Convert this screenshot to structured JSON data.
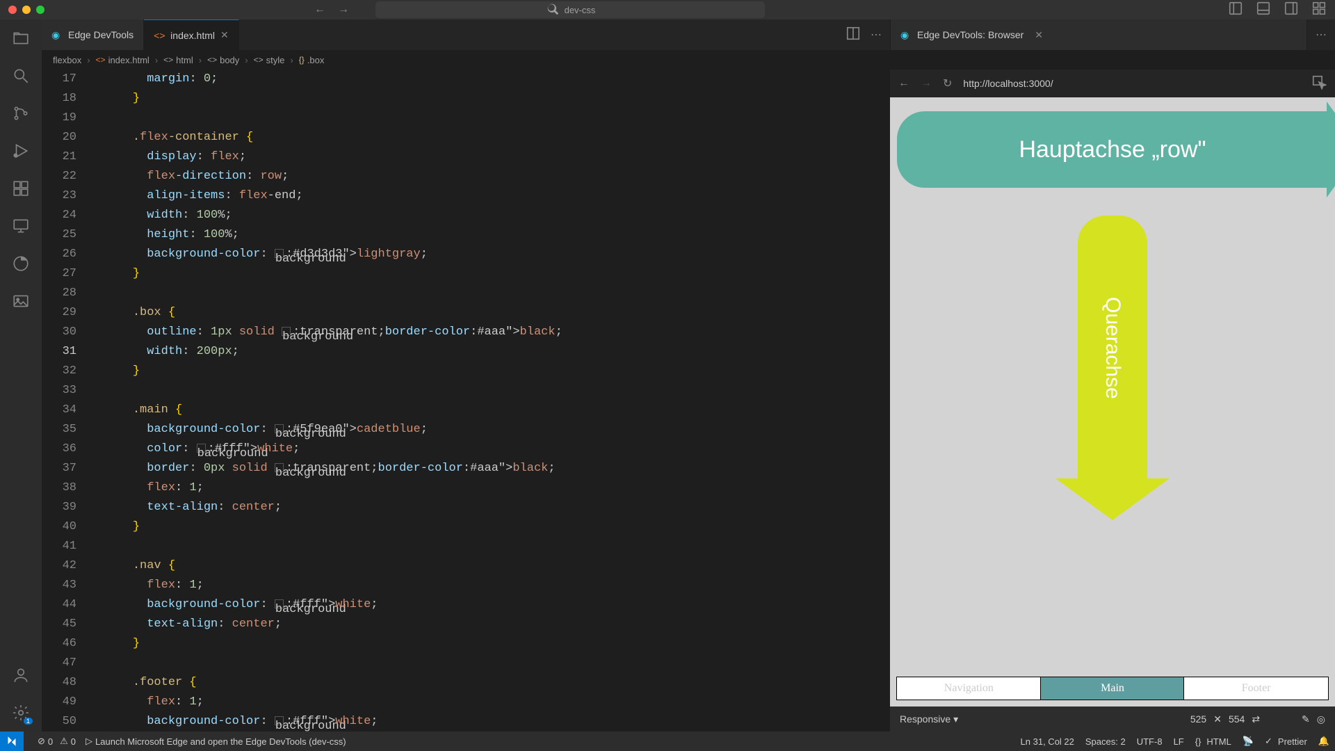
{
  "titlebar": {
    "search_text": "dev-css"
  },
  "tabs": {
    "left": [
      {
        "label": "Edge DevTools"
      },
      {
        "label": "index.html",
        "active": true,
        "dirty": false
      }
    ],
    "right": [
      {
        "label": "Edge DevTools: Browser"
      }
    ]
  },
  "breadcrumbs": [
    "flexbox",
    "index.html",
    "html",
    "body",
    "style",
    ".box"
  ],
  "editor": {
    "first_line": 17,
    "current_line": 31,
    "lines": [
      "      margin: 0;",
      "    }",
      "",
      "    .flex-container {",
      "      display: flex;",
      "      flex-direction: row;",
      "      align-items: flex-end;",
      "      width: 100%;",
      "      height: 100%;",
      "      background-color: ◼ lightgray;",
      "    }",
      "",
      "    .box {",
      "      outline: 1px solid ◻ black;",
      "      width: 200px;",
      "    }",
      "",
      "    .main {",
      "      background-color: ◼ cadetblue;",
      "      color: ◼ white;",
      "      border: 0px solid ◻ black;",
      "      flex: 1;",
      "      text-align: center;",
      "    }",
      "",
      "    .nav {",
      "      flex: 1;",
      "      background-color: ◼ white;",
      "      text-align: center;",
      "    }",
      "",
      "    .footer {",
      "      flex: 1;",
      "      background-color: ◼ white;"
    ]
  },
  "browser": {
    "url": "http://localhost:3000/",
    "arrow_h_text": "Hauptachse „row\"",
    "arrow_v_text": "Querachse",
    "flex_items": [
      "Navigation",
      "Main",
      "Footer"
    ],
    "device": "Responsive",
    "width": "525",
    "height": "554"
  },
  "status": {
    "errors": "0",
    "warnings": "0",
    "launch_text": "Launch Microsoft Edge and open the Edge DevTools (dev-css)",
    "cursor": "Ln 31, Col 22",
    "spaces": "Spaces: 2",
    "encoding": "UTF-8",
    "eol": "LF",
    "lang": "HTML",
    "prettier": "Prettier"
  }
}
